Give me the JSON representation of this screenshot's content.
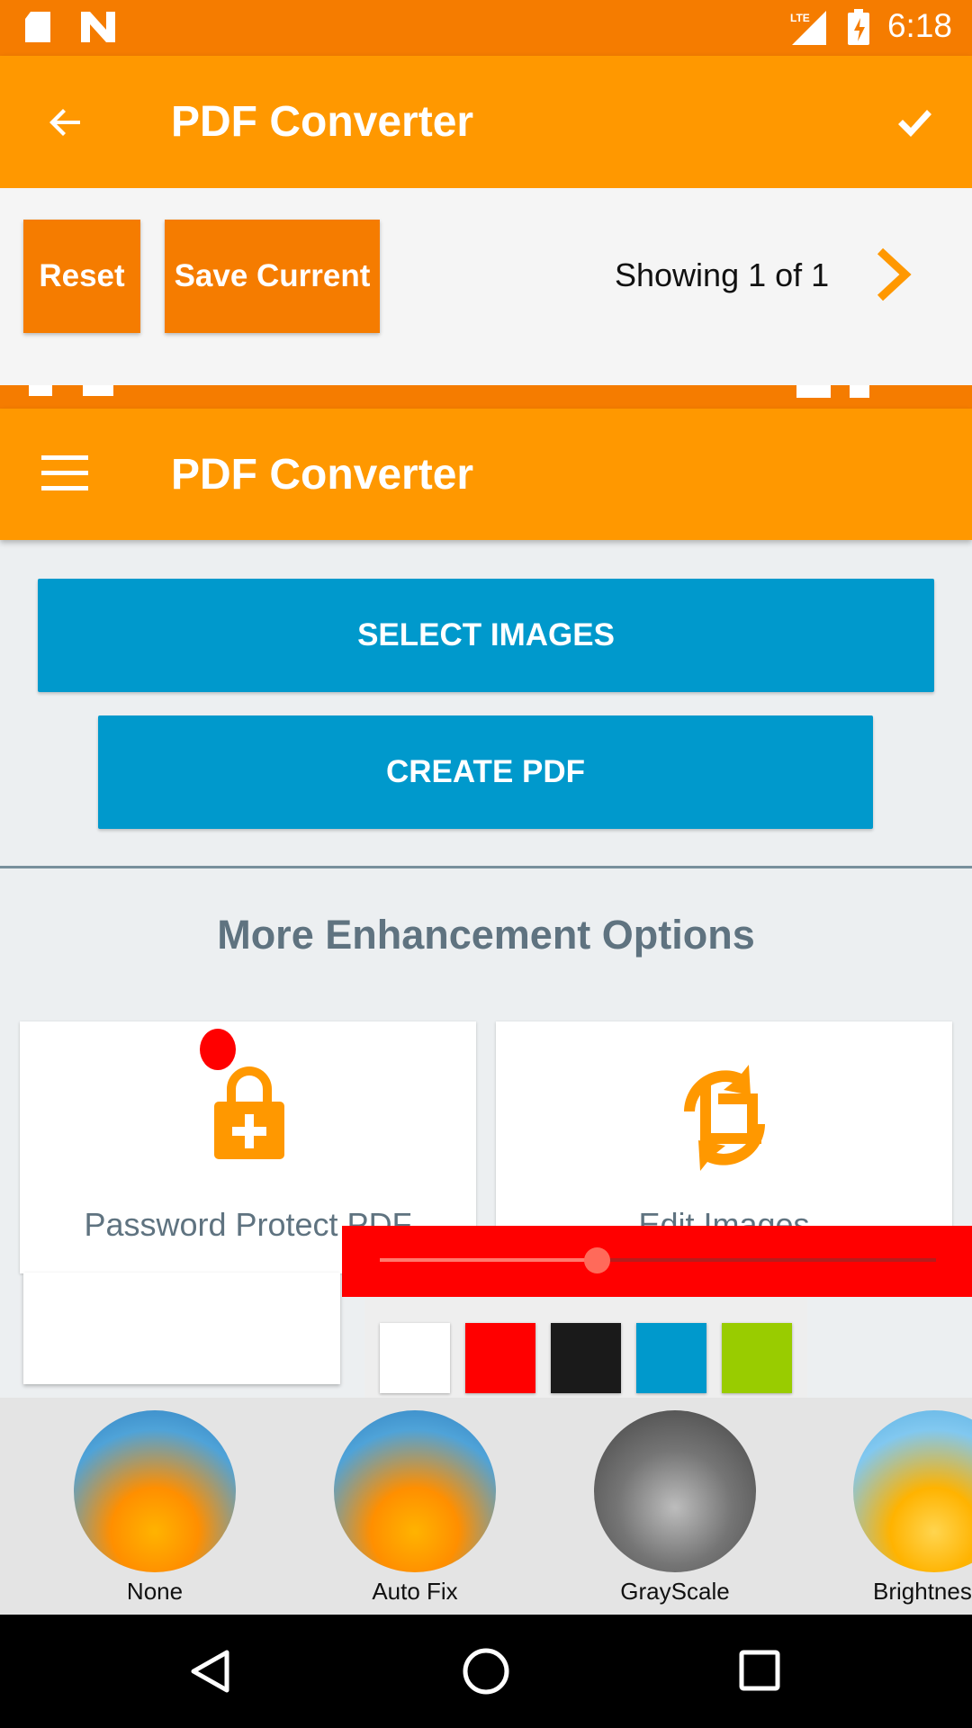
{
  "status_bar": {
    "time": "6:18",
    "network": "LTE"
  },
  "toolbar": {
    "title": "PDF Converter"
  },
  "edit_bar": {
    "reset_label": "Reset",
    "save_label": "Save Current",
    "page_indicator": "Showing 1 of 1"
  },
  "toolbar2": {
    "title": "PDF Converter"
  },
  "main": {
    "select_images_label": "SELECT IMAGES",
    "create_pdf_label": "CREATE PDF",
    "section_title": "More Enhancement Options",
    "cards": [
      {
        "label": "Password Protect PDF",
        "icon": "lock-plus-icon"
      },
      {
        "label": "Edit Images",
        "icon": "crop-rotate-icon"
      }
    ]
  },
  "brush": {
    "size_fraction": 0.39,
    "colors": [
      "#ffffff",
      "#ff0000",
      "#1a1a1a",
      "#0099cc",
      "#99cc00"
    ]
  },
  "filters": [
    {
      "label": "None"
    },
    {
      "label": "Auto Fix"
    },
    {
      "label": "GrayScale"
    },
    {
      "label": "Brightness"
    }
  ],
  "colors": {
    "accent": "#ff9800",
    "status": "#f57c00",
    "button_blue": "#0099cc",
    "brush_red": "#ff0000"
  }
}
